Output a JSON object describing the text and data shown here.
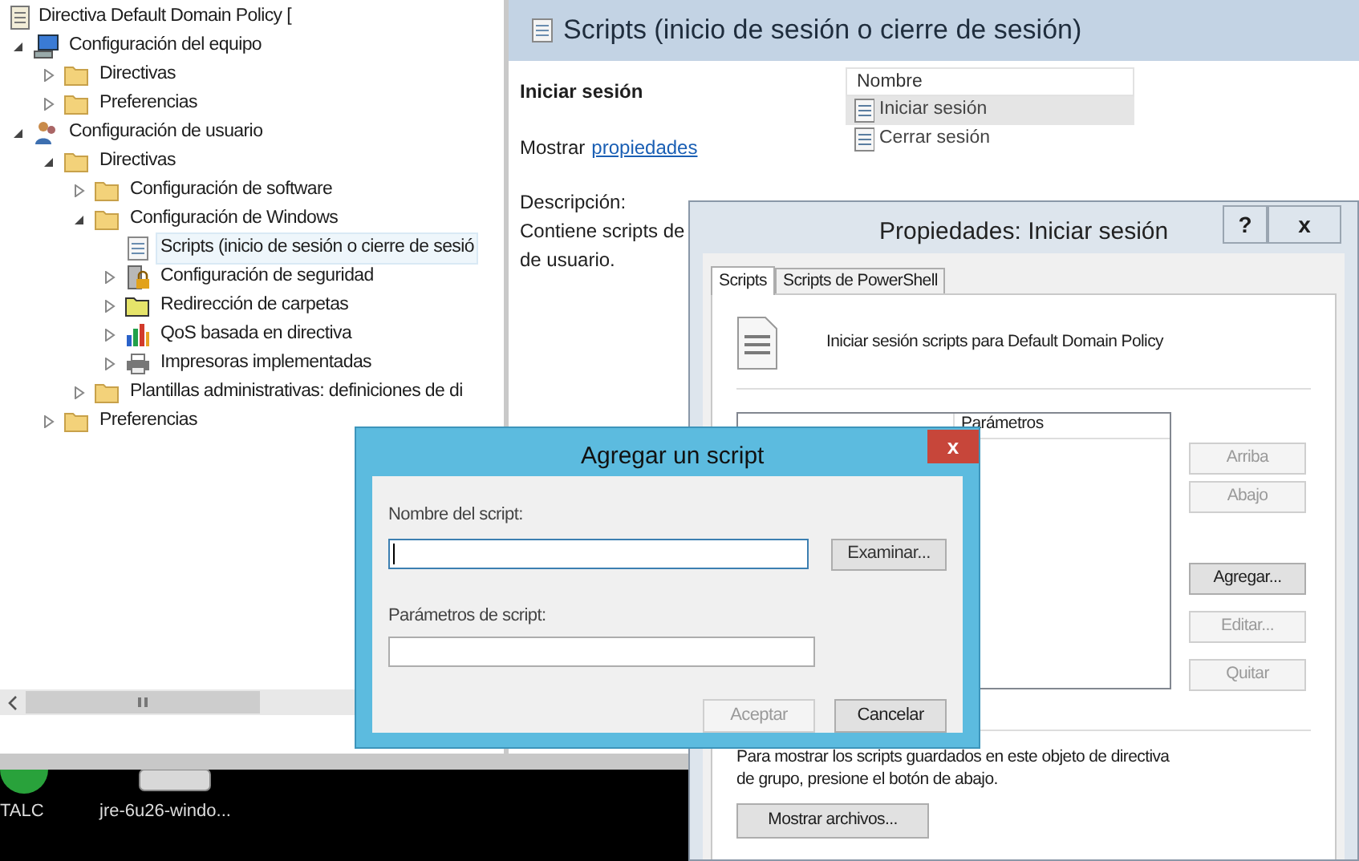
{
  "desktop": {
    "icons": [
      {
        "label": "TALC",
        "kind": "green"
      },
      {
        "label": "jre-6u26-windo...",
        "kind": "installer"
      }
    ]
  },
  "editor": {
    "tree": {
      "title": "Directiva Default Domain Policy [",
      "items": [
        {
          "label": "Configuración del equipo",
          "kind": "computer",
          "expanded": true,
          "selected": false,
          "children": [
            {
              "label": "Directivas",
              "kind": "folder",
              "expanded": false,
              "selected": false
            },
            {
              "label": "Preferencias",
              "kind": "folder",
              "expanded": false,
              "selected": false
            }
          ]
        },
        {
          "label": "Configuración de usuario",
          "kind": "user",
          "expanded": true,
          "selected": false,
          "children": [
            {
              "label": "Directivas",
              "kind": "folder",
              "expanded": true,
              "selected": false,
              "children": [
                {
                  "label": "Configuración de software",
                  "kind": "folder",
                  "expanded": false,
                  "selected": false
                },
                {
                  "label": "Configuración de Windows",
                  "kind": "folder",
                  "expanded": true,
                  "selected": false,
                  "children": [
                    {
                      "label": "Scripts (inicio de sesión o cierre de sesió",
                      "kind": "script",
                      "selected": true
                    },
                    {
                      "label": "Configuración de seguridad",
                      "kind": "security",
                      "expanded": false,
                      "selected": false
                    },
                    {
                      "label": "Redirección de carpetas",
                      "kind": "redirect",
                      "expanded": false,
                      "selected": false
                    },
                    {
                      "label": "QoS basada en directiva",
                      "kind": "chart",
                      "expanded": false,
                      "selected": false
                    },
                    {
                      "label": "Impresoras implementadas",
                      "kind": "printer",
                      "expanded": false,
                      "selected": false
                    }
                  ]
                },
                {
                  "label": "Plantillas administrativas: definiciones de di",
                  "kind": "folder",
                  "expanded": false,
                  "selected": false
                }
              ]
            },
            {
              "label": "Preferencias",
              "kind": "folder",
              "expanded": false,
              "selected": false
            }
          ]
        }
      ]
    },
    "pane": {
      "title": "Scripts (inicio de sesión o cierre de sesión)",
      "heading": "Iniciar sesión",
      "show_label": "Mostrar",
      "show_link": "propiedades",
      "description_label": "Descripción:",
      "description_lines": [
        "Contiene scripts de",
        "de usuario."
      ],
      "list": {
        "column": "Nombre",
        "rows": [
          {
            "name": "Iniciar sesión",
            "selected": true
          },
          {
            "name": "Cerrar sesión",
            "selected": false
          }
        ]
      }
    }
  },
  "properties": {
    "title": "Propiedades: Iniciar sesión",
    "help": "?",
    "close": "x",
    "tabs": [
      {
        "label": "Scripts",
        "selected": true
      },
      {
        "label": "Scripts de PowerShell",
        "selected": false
      }
    ],
    "intro": "Iniciar sesión scripts para Default Domain Policy",
    "params_column": "Parámetros",
    "buttons": [
      {
        "label": "Arriba",
        "disabled": true
      },
      {
        "label": "Abajo",
        "disabled": true
      },
      {
        "label": "Agregar...",
        "disabled": false
      },
      {
        "label": "Editar...",
        "disabled": true
      },
      {
        "label": "Quitar",
        "disabled": true
      }
    ],
    "note_lines": [
      "Para mostrar los scripts guardados en este objeto de directiva",
      "de grupo, presione el botón de abajo."
    ],
    "show_files": "Mostrar archivos..."
  },
  "add_dialog": {
    "title": "Agregar un script",
    "close": "x",
    "name_label": "Nombre del script:",
    "browse": "Examinar...",
    "params_label": "Parámetros de script:",
    "buttons": [
      {
        "label": "Aceptar",
        "disabled": true
      },
      {
        "label": "Cancelar",
        "disabled": false
      }
    ]
  }
}
